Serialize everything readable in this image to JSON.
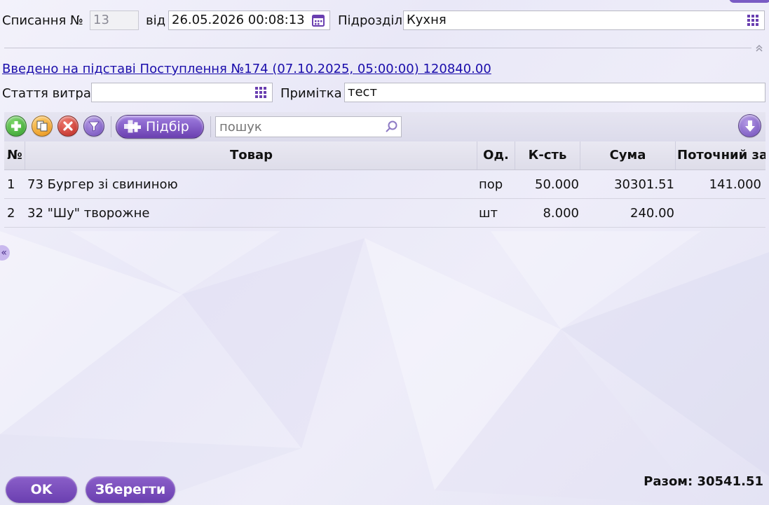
{
  "header": {
    "doc_label": "Списання №",
    "doc_number": "13",
    "date_label": "від",
    "date_value": "26.05.2026 00:08:13",
    "dept_label": "Підрозділ",
    "dept_value": "Кухня"
  },
  "basis_link": "Введено на підставі Поступлення №174 (07.10.2025, 05:00:00) 120840.00",
  "expense": {
    "label": "Стаття витрат",
    "value": ""
  },
  "note": {
    "label": "Примітка",
    "value": "тест"
  },
  "toolbar": {
    "pick_label": "Підбір",
    "search_placeholder": "пошук"
  },
  "table": {
    "columns": [
      "№",
      "Товар",
      "Од.",
      "К-сть",
      "Сума",
      "Поточний за"
    ],
    "rows": [
      {
        "num": "1",
        "name": "73 Бургер зі свининою",
        "unit": "пор",
        "qty": "50.000",
        "sum": "30301.51",
        "current": "141.000"
      },
      {
        "num": "2",
        "name": "32 \"Шу\" творожне",
        "unit": "шт",
        "qty": "8.000",
        "sum": "240.00",
        "current": ""
      }
    ]
  },
  "side_toggle": "«",
  "footer": {
    "ok_label": "OK",
    "save_label": "Зберегти",
    "total_text": "Разом: 30541.51"
  },
  "colors": {
    "accent": "#6a3fb0",
    "link": "#1a0dab",
    "add": "#3aa534",
    "copy": "#f2a21c",
    "delete": "#c8302a",
    "filter": "#7a5cc4"
  }
}
